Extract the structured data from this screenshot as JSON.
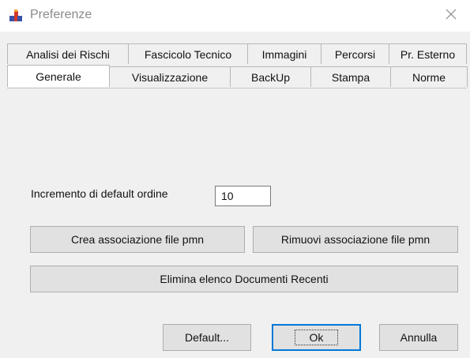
{
  "window": {
    "title": "Preferenze",
    "close_glyph": "×",
    "icon": "app-logo-icon"
  },
  "tabs": {
    "row1": [
      {
        "label": "Analisi dei Rischi"
      },
      {
        "label": "Fascicolo Tecnico"
      },
      {
        "label": "Immagini"
      },
      {
        "label": "Percorsi"
      },
      {
        "label": "Pr. Esterno"
      }
    ],
    "row2": [
      {
        "label": "Generale",
        "active": true
      },
      {
        "label": "Visualizzazione"
      },
      {
        "label": "BackUp"
      },
      {
        "label": "Stampa"
      },
      {
        "label": "Norme"
      }
    ]
  },
  "general": {
    "increment_label": "Incremento di default ordine",
    "increment_value": "10",
    "create_assoc_label": "Crea associazione file pmn",
    "remove_assoc_label": "Rimuovi associazione file pmn",
    "clear_recent_label": "Elimina elenco Documenti Recenti"
  },
  "footer": {
    "default_label": "Default...",
    "ok_label": "Ok",
    "cancel_label": "Annulla"
  },
  "colors": {
    "window_bg": "#f0f0f0",
    "title_text": "#8a8a8a",
    "button_bg": "#e1e1e1",
    "focus_blue": "#0078d7",
    "icon_blue": "#3a52a8",
    "icon_red": "#d33a2c"
  }
}
